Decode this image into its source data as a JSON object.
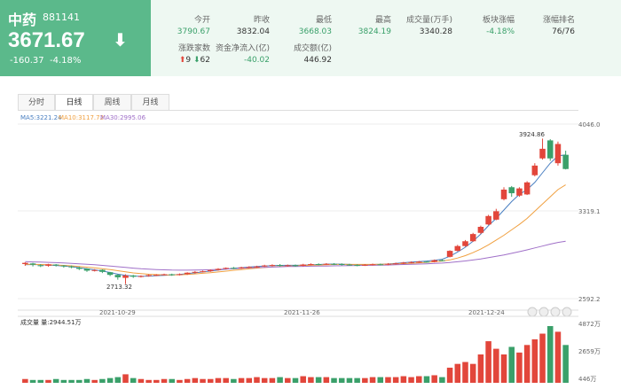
{
  "header": {
    "name": "中药",
    "code": "881141",
    "price": "3671.67",
    "change": "-160.37",
    "change_pct": "-4.18%",
    "arrow": "⬇",
    "stats": [
      {
        "label": "今开",
        "value": "3790.67",
        "tone": "green"
      },
      {
        "label": "昨收",
        "value": "3832.04",
        "tone": "plain"
      },
      {
        "label": "最低",
        "value": "3668.03",
        "tone": "green"
      },
      {
        "label": "最高",
        "value": "3824.19",
        "tone": "green"
      },
      {
        "label": "成交量(万手)",
        "value": "3340.28",
        "tone": "plain"
      },
      {
        "label": "板块涨幅",
        "value": "-4.18%",
        "tone": "green"
      },
      {
        "label": "涨幅排名",
        "value": "76/76",
        "tone": "plain"
      },
      {
        "label": "涨跌家数",
        "value": "",
        "tone": "plain"
      },
      {
        "label": "资金净流入(亿)",
        "value": "-40.02",
        "tone": "green"
      },
      {
        "label": "成交额(亿)",
        "value": "446.92",
        "tone": "plain"
      }
    ],
    "up_count": "9",
    "down_count": "62"
  },
  "tabs": [
    {
      "label": "分时",
      "active": false
    },
    {
      "label": "日线",
      "active": true
    },
    {
      "label": "周线",
      "active": false
    },
    {
      "label": "月线",
      "active": false
    }
  ],
  "chart_data": {
    "type": "candlestick",
    "ma_legend": [
      {
        "text": "MA5:3221.24",
        "color": "#4a7fc1"
      },
      {
        "text": "MA10:3117.72",
        "color": "#f0a040"
      },
      {
        "text": "MA30:2995.06",
        "color": "#a070c8"
      }
    ],
    "price_axis": {
      "labels": [
        "4046.0",
        "3319.1",
        "2592.2"
      ],
      "values": [
        4046.0,
        3319.1,
        2592.2
      ]
    },
    "date_labels": [
      "2021-10-29",
      "2021-11-26",
      "2021-12-24"
    ],
    "annotations": {
      "high": "3924.86",
      "low": "2713.32"
    },
    "volume": {
      "legend": "成交量 量:2944.51万",
      "labels": [
        "4872万",
        "2659万",
        "446万"
      ]
    },
    "up_color": "#e2463b",
    "down_color": "#3aa06a",
    "candles": [
      [
        2880,
        2890,
        2865,
        2895
      ],
      [
        2885,
        2875,
        2860,
        2890
      ],
      [
        2870,
        2868,
        2855,
        2880
      ],
      [
        2866,
        2878,
        2858,
        2882
      ],
      [
        2876,
        2870,
        2860,
        2880
      ],
      [
        2868,
        2862,
        2850,
        2872
      ],
      [
        2860,
        2855,
        2845,
        2868
      ],
      [
        2850,
        2840,
        2830,
        2858
      ],
      [
        2842,
        2825,
        2815,
        2846
      ],
      [
        2826,
        2830,
        2818,
        2838
      ],
      [
        2832,
        2815,
        2805,
        2836
      ],
      [
        2812,
        2790,
        2780,
        2815
      ],
      [
        2790,
        2770,
        2750,
        2795
      ],
      [
        2765,
        2785,
        2713,
        2795
      ],
      [
        2785,
        2775,
        2765,
        2790
      ],
      [
        2776,
        2780,
        2768,
        2786
      ],
      [
        2780,
        2788,
        2775,
        2795
      ],
      [
        2788,
        2790,
        2780,
        2796
      ],
      [
        2790,
        2795,
        2785,
        2800
      ],
      [
        2795,
        2790,
        2782,
        2800
      ],
      [
        2790,
        2796,
        2785,
        2802
      ],
      [
        2796,
        2808,
        2790,
        2812
      ],
      [
        2810,
        2815,
        2800,
        2822
      ],
      [
        2816,
        2820,
        2810,
        2826
      ],
      [
        2820,
        2830,
        2815,
        2836
      ],
      [
        2830,
        2840,
        2825,
        2846
      ],
      [
        2842,
        2848,
        2835,
        2852
      ],
      [
        2848,
        2845,
        2838,
        2856
      ],
      [
        2844,
        2852,
        2840,
        2858
      ],
      [
        2852,
        2856,
        2845,
        2862
      ],
      [
        2856,
        2860,
        2848,
        2866
      ],
      [
        2860,
        2868,
        2855,
        2874
      ],
      [
        2868,
        2872,
        2860,
        2878
      ],
      [
        2872,
        2868,
        2860,
        2880
      ],
      [
        2868,
        2870,
        2858,
        2876
      ],
      [
        2870,
        2866,
        2858,
        2876
      ],
      [
        2866,
        2876,
        2860,
        2882
      ],
      [
        2876,
        2880,
        2870,
        2886
      ],
      [
        2880,
        2878,
        2870,
        2886
      ],
      [
        2878,
        2882,
        2872,
        2888
      ],
      [
        2882,
        2880,
        2872,
        2888
      ],
      [
        2880,
        2876,
        2868,
        2886
      ],
      [
        2876,
        2872,
        2866,
        2882
      ],
      [
        2872,
        2870,
        2862,
        2878
      ],
      [
        2870,
        2874,
        2864,
        2880
      ],
      [
        2874,
        2878,
        2868,
        2884
      ],
      [
        2878,
        2876,
        2870,
        2884
      ],
      [
        2876,
        2882,
        2870,
        2888
      ],
      [
        2882,
        2886,
        2876,
        2892
      ],
      [
        2886,
        2892,
        2880,
        2898
      ],
      [
        2892,
        2896,
        2886,
        2902
      ],
      [
        2896,
        2900,
        2890,
        2906
      ],
      [
        2900,
        2898,
        2892,
        2906
      ],
      [
        2898,
        2912,
        2894,
        2918
      ],
      [
        2912,
        2910,
        2902,
        2920
      ],
      [
        2940,
        2990,
        2935,
        2995
      ],
      [
        2990,
        3030,
        2985,
        3040
      ],
      [
        3030,
        3070,
        3025,
        3080
      ],
      [
        3070,
        3130,
        3065,
        3140
      ],
      [
        3140,
        3190,
        3130,
        3200
      ],
      [
        3210,
        3280,
        3205,
        3290
      ],
      [
        3250,
        3320,
        3245,
        3340
      ],
      [
        3420,
        3500,
        3410,
        3520
      ],
      [
        3520,
        3470,
        3440,
        3530
      ],
      [
        3450,
        3510,
        3440,
        3520
      ],
      [
        3460,
        3560,
        3455,
        3570
      ],
      [
        3620,
        3700,
        3610,
        3720
      ],
      [
        3760,
        3840,
        3750,
        3924.86
      ],
      [
        3910,
        3760,
        3740,
        3920
      ],
      [
        3720,
        3880,
        3700,
        3900
      ],
      [
        3790,
        3671.67,
        3668.03,
        3824.19
      ]
    ],
    "volumes": [
      4,
      3,
      3,
      3,
      4,
      3,
      3,
      3,
      4,
      3,
      4,
      5,
      6,
      9,
      5,
      4,
      3,
      3,
      4,
      4,
      3,
      4,
      5,
      4,
      4,
      5,
      5,
      4,
      5,
      5,
      6,
      5,
      5,
      6,
      5,
      5,
      7,
      6,
      6,
      6,
      5,
      5,
      5,
      5,
      5,
      6,
      6,
      6,
      6,
      7,
      6,
      7,
      7,
      8,
      6,
      16,
      20,
      22,
      20,
      30,
      44,
      36,
      30,
      38,
      32,
      40,
      46,
      52,
      60,
      54,
      40
    ],
    "volume_up": [
      1,
      0,
      0,
      1,
      0,
      0,
      0,
      0,
      0,
      1,
      0,
      0,
      0,
      1,
      0,
      1,
      1,
      1,
      1,
      0,
      1,
      1,
      1,
      1,
      1,
      1,
      1,
      0,
      1,
      1,
      1,
      1,
      1,
      0,
      1,
      0,
      1,
      1,
      0,
      1,
      0,
      0,
      0,
      0,
      1,
      1,
      0,
      1,
      1,
      1,
      1,
      1,
      0,
      1,
      0,
      1,
      1,
      1,
      1,
      1,
      1,
      1,
      1,
      0,
      1,
      1,
      1,
      1,
      0,
      1,
      0
    ],
    "ma5": [
      2875,
      2876,
      2874,
      2871,
      2868,
      2864,
      2858,
      2850,
      2840,
      2832,
      2822,
      2810,
      2796,
      2786,
      2780,
      2778,
      2780,
      2783,
      2786,
      2790,
      2794,
      2800,
      2807,
      2814,
      2822,
      2830,
      2838,
      2845,
      2850,
      2855,
      2860,
      2864,
      2867,
      2869,
      2870,
      2870,
      2871,
      2873,
      2876,
      2879,
      2880,
      2879,
      2877,
      2875,
      2874,
      2876,
      2878,
      2881,
      2886,
      2891,
      2896,
      2900,
      2905,
      2912,
      2920,
      2945,
      2980,
      3020,
      3070,
      3130,
      3200,
      3260,
      3330,
      3400,
      3460,
      3500,
      3560,
      3640,
      3720,
      3780,
      3790
    ],
    "ma10": [
      2878,
      2877,
      2876,
      2874,
      2872,
      2869,
      2865,
      2860,
      2854,
      2848,
      2842,
      2834,
      2825,
      2815,
      2806,
      2800,
      2795,
      2792,
      2790,
      2790,
      2791,
      2794,
      2798,
      2803,
      2808,
      2814,
      2821,
      2828,
      2834,
      2840,
      2846,
      2851,
      2856,
      2860,
      2863,
      2866,
      2868,
      2870,
      2872,
      2874,
      2876,
      2877,
      2877,
      2877,
      2877,
      2877,
      2878,
      2879,
      2881,
      2884,
      2887,
      2890,
      2894,
      2899,
      2905,
      2915,
      2930,
      2950,
      2975,
      3005,
      3040,
      3080,
      3120,
      3165,
      3210,
      3260,
      3320,
      3380,
      3440,
      3500,
      3540
    ],
    "ma30": [
      2900,
      2898,
      2896,
      2894,
      2892,
      2889,
      2886,
      2882,
      2878,
      2874,
      2869,
      2864,
      2858,
      2852,
      2846,
      2841,
      2837,
      2834,
      2832,
      2830,
      2829,
      2829,
      2830,
      2831,
      2833,
      2836,
      2839,
      2842,
      2845,
      2848,
      2851,
      2853,
      2855,
      2857,
      2859,
      2860,
      2861,
      2862,
      2863,
      2864,
      2865,
      2866,
      2867,
      2868,
      2869,
      2870,
      2871,
      2872,
      2874,
      2876,
      2878,
      2880,
      2882,
      2885,
      2888,
      2893,
      2899,
      2906,
      2914,
      2923,
      2933,
      2944,
      2956,
      2969,
      2983,
      2998,
      3014,
      3030,
      3046,
      3060,
      3070
    ]
  }
}
